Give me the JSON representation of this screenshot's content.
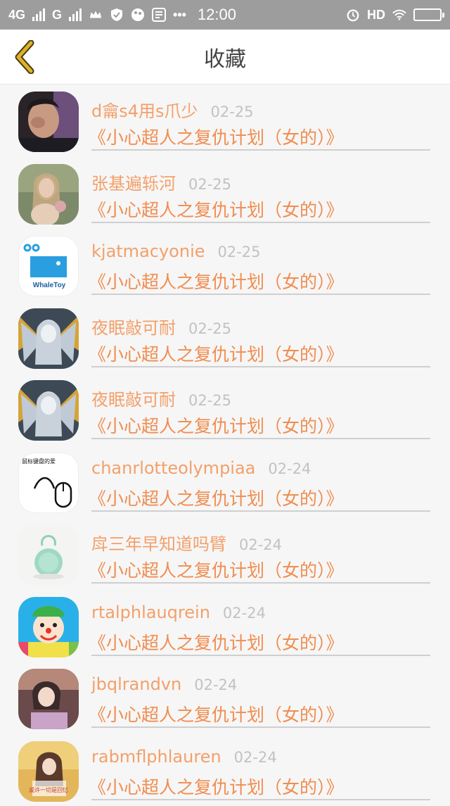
{
  "status_bar": {
    "net1": "4G",
    "net2": "G",
    "time": "12:00",
    "hd": "HD"
  },
  "header": {
    "title": "收藏"
  },
  "favorites": [
    {
      "name": "d龠s4用s爪少",
      "date": "02-25",
      "topic": "《小心超人之复仇计划（女的）》",
      "avatar": "boy-photo"
    },
    {
      "name": "张基遍轹河",
      "date": "02-25",
      "topic": "《小心超人之复仇计划（女的）》",
      "avatar": "girl-photo"
    },
    {
      "name": "kjatmacyonie",
      "date": "02-25",
      "topic": "《小心超人之复仇计划（女的）》",
      "avatar": "whaletoy-logo",
      "avatar_text": "WhaleToy"
    },
    {
      "name": "夜眠敲可耐",
      "date": "02-25",
      "topic": "《小心超人之复仇计划（女的）》",
      "avatar": "angel-art"
    },
    {
      "name": "夜眠敲可耐",
      "date": "02-25",
      "topic": "《小心超人之复仇计划（女的）》",
      "avatar": "angel-art"
    },
    {
      "name": "chanrlotteolympiaa",
      "date": "02-24",
      "topic": "《小心超人之复仇计划（女的）》",
      "avatar": "mouse-drawing",
      "avatar_text": "鼠标键盘的爱"
    },
    {
      "name": "戽三年早知道吗臂",
      "date": "02-24",
      "topic": "《小心超人之复仇计划（女的）》",
      "avatar": "green-bag"
    },
    {
      "name": "rtalphlauqrein",
      "date": "02-24",
      "topic": "《小心超人之复仇计划（女的）》",
      "avatar": "clown-art"
    },
    {
      "name": "jbqlrandvn",
      "date": "02-24",
      "topic": "《小心超人之复仇计划（女的）》",
      "avatar": "girl-photo-2"
    },
    {
      "name": "rabmflphlauren",
      "date": "02-24",
      "topic": "《小心超人之复仇计划（女的）》",
      "avatar": "woman-photo",
      "avatar_text": "或许一切是回忆"
    }
  ],
  "colors": {
    "accent_name": "#f3a06a",
    "accent_topic": "#f08d4f",
    "date_gray": "#c2c2c2",
    "back_arrow": "#e0b02a"
  }
}
